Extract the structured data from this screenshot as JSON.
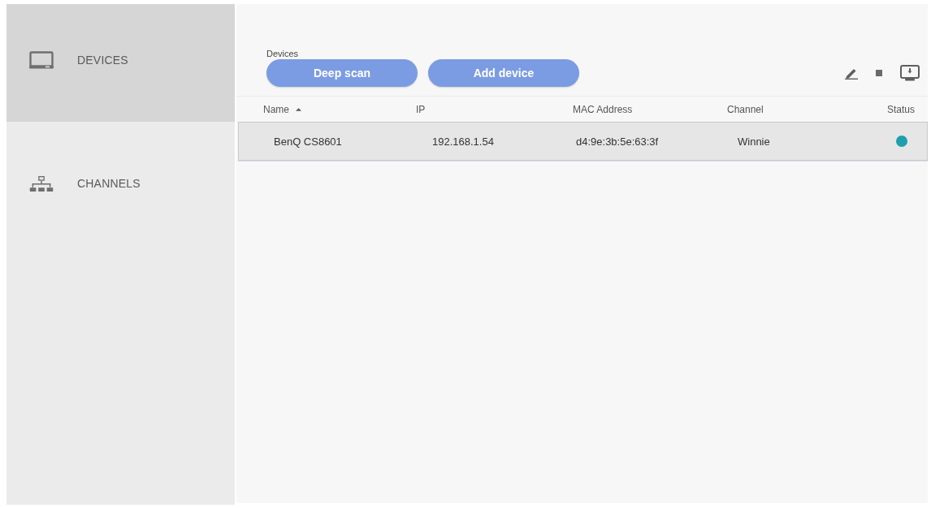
{
  "sidebar": {
    "items": [
      {
        "kind": "devices",
        "label": "DEVICES",
        "selected": true
      },
      {
        "kind": "channels",
        "label": "CHANNELS",
        "selected": false
      }
    ]
  },
  "main": {
    "title": "Devices",
    "buttons": [
      "Deep scan",
      "Add device"
    ]
  },
  "table": {
    "columns": [
      {
        "label": "Name",
        "sorted": true
      },
      {
        "label": "IP",
        "sorted": false
      },
      {
        "label": "MAC Address",
        "sorted": false
      },
      {
        "label": "Channel",
        "sorted": false
      },
      {
        "label": "Status",
        "sorted": false
      }
    ],
    "rows": [
      {
        "name": "BenQ CS8601",
        "ip": "192.168.1.54",
        "mac": "d4:9e:3b:5e:63:3f",
        "channel": "Winnie",
        "color": "#1e9fae",
        "selected": true
      }
    ]
  }
}
